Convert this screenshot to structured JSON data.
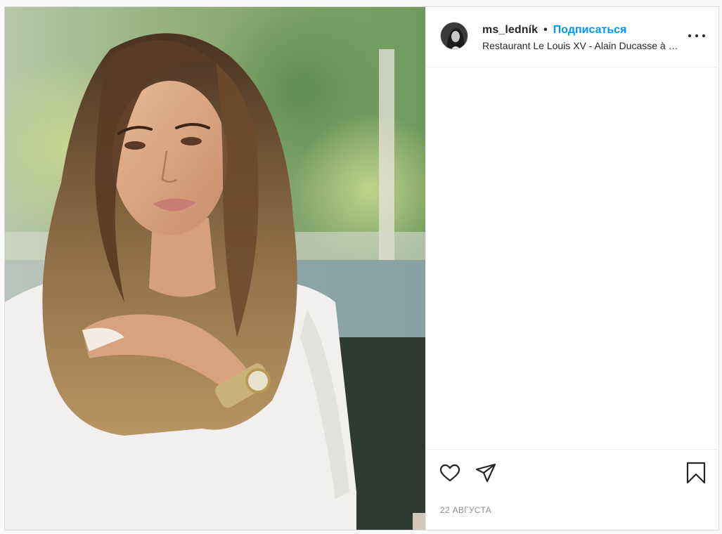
{
  "post": {
    "image_alt": "",
    "username": "ms_ledník",
    "separator": "•",
    "follow_label": "Подписаться",
    "location": "Restaurant Le Louis XV - Alain Ducasse à l'Hôtel de Paris",
    "more_icon": "more-horizontal-icon",
    "date": "22 августа"
  },
  "actions": {
    "like_icon": "heart-icon",
    "share_icon": "paper-plane-icon",
    "save_icon": "bookmark-icon"
  },
  "colors": {
    "follow": "#0095f6",
    "text": "#262626",
    "muted": "#8e8e8e",
    "border": "#dbdbdb"
  }
}
